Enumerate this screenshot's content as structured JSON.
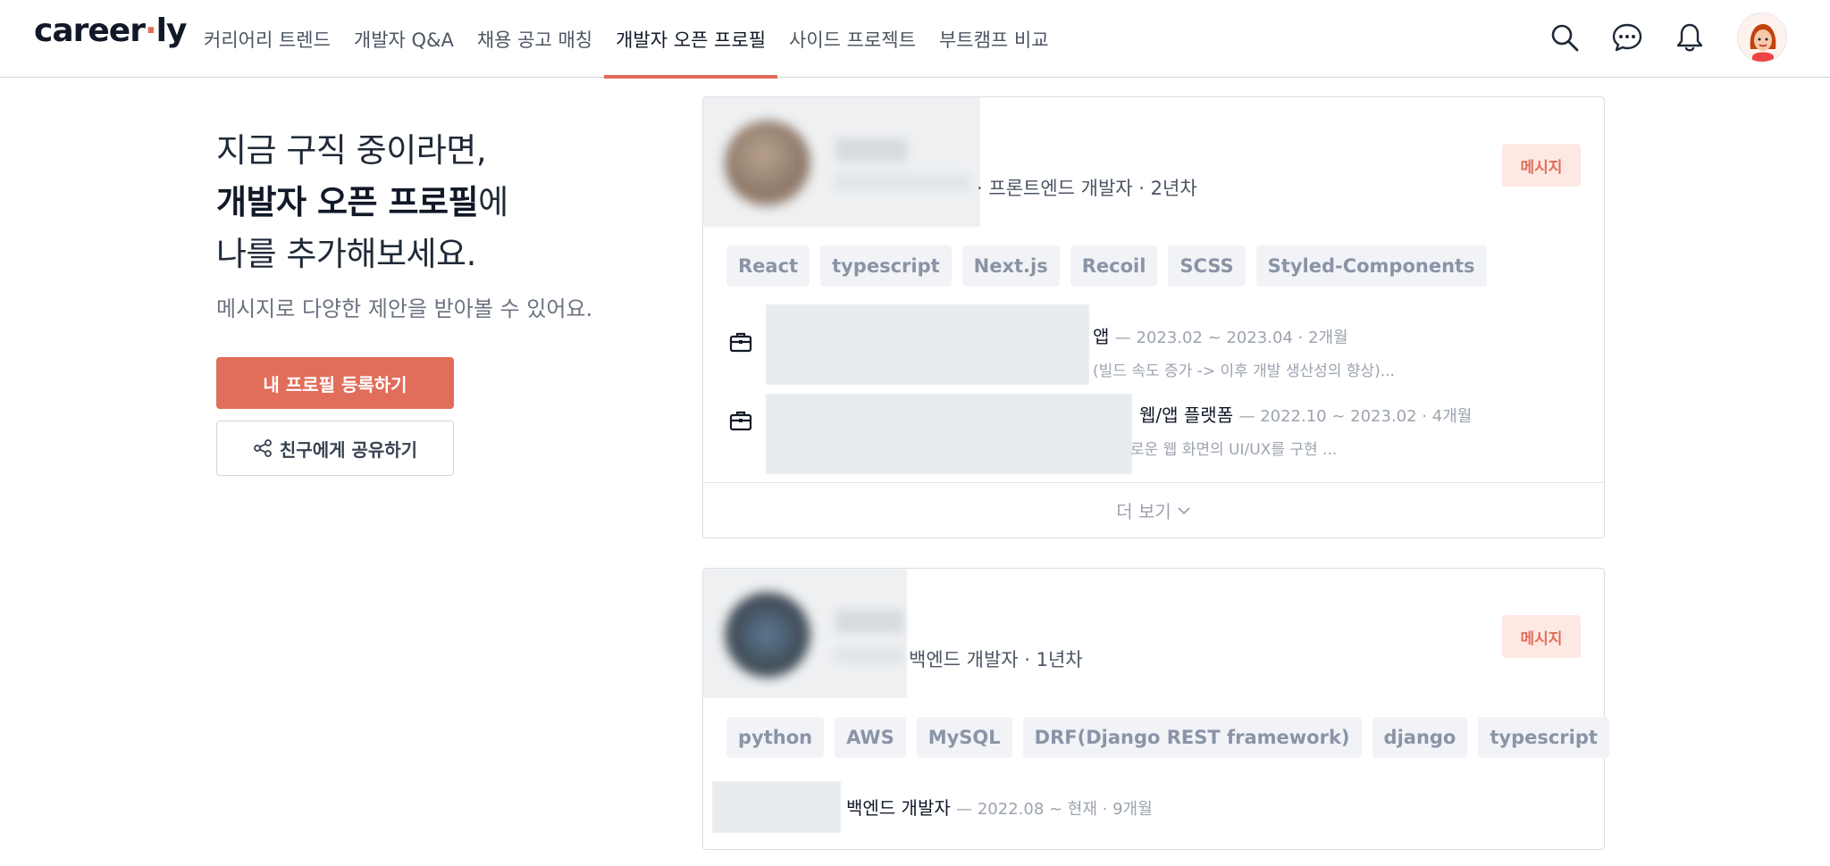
{
  "header": {
    "logo": {
      "text": "career",
      "dot": "·",
      "suffix": "ly"
    },
    "nav": [
      {
        "label": "커리어리 트렌드",
        "active": false
      },
      {
        "label": "개발자 Q&A",
        "active": false
      },
      {
        "label": "채용 공고 매칭",
        "active": false
      },
      {
        "label": "개발자 오픈 프로필",
        "active": true
      },
      {
        "label": "사이드 프로젝트",
        "active": false
      },
      {
        "label": "부트캠프 비교",
        "active": false
      }
    ],
    "icons": [
      "search-icon",
      "chat-icon",
      "bell-icon",
      "avatar"
    ]
  },
  "hero": {
    "line1": "지금 구직 중이라면,",
    "line2_bold": "개발자 오픈 프로필",
    "line2_rest": "에",
    "line3": "나를 추가해보세요.",
    "subtitle": "메시지로 다양한 제안을 받아볼 수 있어요.",
    "primary_button": "내 프로필 등록하기",
    "share_button": "친구에게 공유하기"
  },
  "profiles": [
    {
      "role": "프론트엔드 개발자 · 2년차",
      "role_prefix": "·",
      "message_label": "메시지",
      "tags": [
        "React",
        "typescript",
        "Next.js",
        "Recoil",
        "SCSS",
        "Styled-Components"
      ],
      "experiences": [
        {
          "title_visible": "앱",
          "meta": "— 2023.02 ~ 2023.04 · 2개월",
          "desc_visible": "(빌드 속도 증가 -> 이후 개발 생산성의 향상)..."
        },
        {
          "title_visible": "웹/앱 플랫폼",
          "meta": "— 2022.10 ~ 2023.02 · 4개월",
          "desc_visible": "로운 웹 화면의 UI/UX를 구현 ..."
        }
      ],
      "more_label": "더 보기"
    },
    {
      "role": "백엔드 개발자 · 1년차",
      "message_label": "메시지",
      "tags": [
        "python",
        "AWS",
        "MySQL",
        "DRF(Django REST framework)",
        "django",
        "typescript"
      ],
      "experiences": [
        {
          "title_visible": "백엔드 개발자",
          "meta": "— 2022.08 ~ 현재 · 9개월"
        }
      ]
    }
  ],
  "colors": {
    "accent": "#e06e5a",
    "tag_bg": "#f1f3f7",
    "tag_text": "#8a94a6"
  }
}
